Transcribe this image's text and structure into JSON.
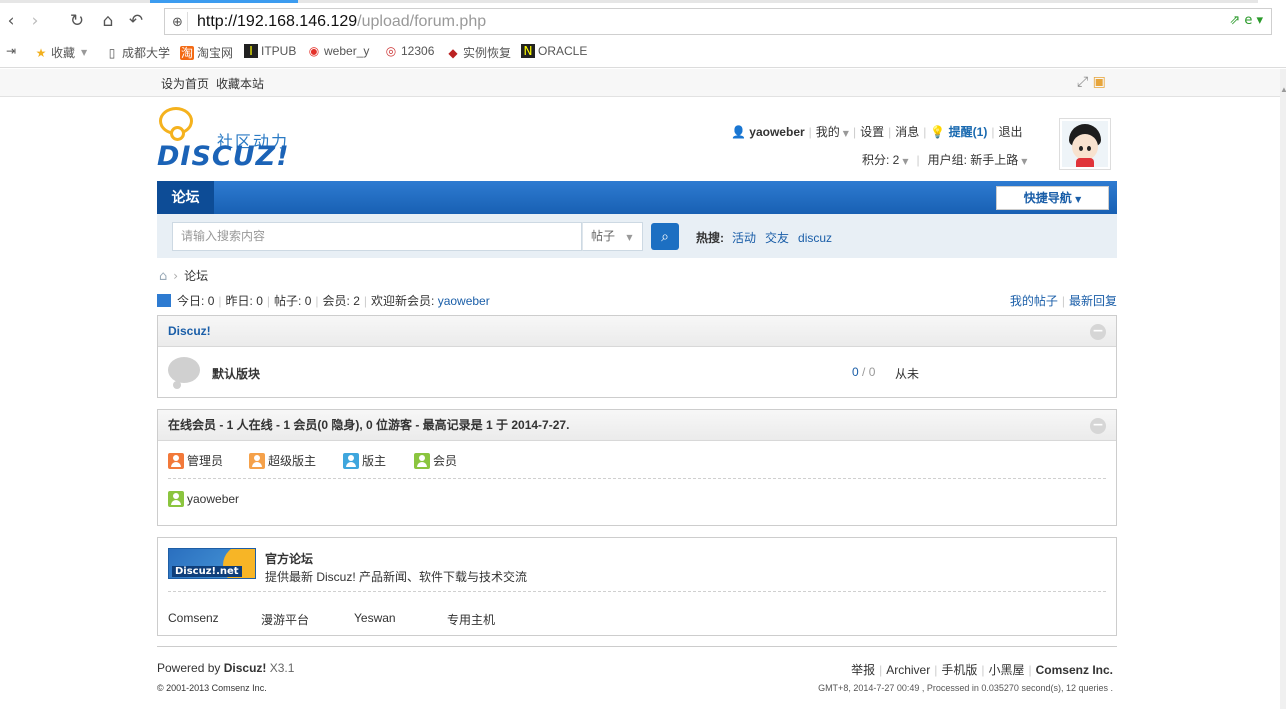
{
  "browser": {
    "url_host": "http://192.168.146.129",
    "url_path": "/upload/forum.php",
    "bookmarks": [
      "收藏",
      "成都大学",
      "淘宝网",
      "ITPUB",
      "weber_y",
      "12306",
      "实例恢复",
      "ORACLE"
    ]
  },
  "topbar": {
    "set_home": "设为首页",
    "bookmark_site": "收藏本站"
  },
  "logo": {
    "cn": "社区动力",
    "en": "DISCUZ!"
  },
  "user": {
    "name": "yaoweber",
    "my": "我的",
    "settings": "设置",
    "messages": "消息",
    "remind": "提醒(1)",
    "logout": "退出",
    "credits": "积分: 2",
    "group": "用户组: 新手上路"
  },
  "nav": {
    "forum_tab": "论坛",
    "quick_nav": "快捷导航"
  },
  "search": {
    "placeholder": "请输入搜索内容",
    "type": "帖子",
    "hot_label": "热搜:",
    "hot": [
      "活动",
      "交友",
      "discuz"
    ]
  },
  "breadcrumb": {
    "current": "论坛"
  },
  "stats": {
    "today_label": "今日:",
    "today": "0",
    "yesterday_label": "昨日:",
    "yesterday": "0",
    "posts_label": "帖子:",
    "posts": "0",
    "members_label": "会员:",
    "members": "2",
    "welcome_label": "欢迎新会员:",
    "newest": "yaoweber",
    "my_posts": "我的帖子",
    "latest_replies": "最新回复"
  },
  "category": {
    "title": "Discuz!",
    "forums": [
      {
        "name": "默认版块",
        "threads": "0",
        "posts": "0",
        "last": "从未"
      }
    ]
  },
  "online": {
    "title": "在线会员 - 1 人在线 - 1 会员(0 隐身), 0 位游客 - 最高记录是 1 于 2014-7-27.",
    "legend": [
      "管理员",
      "超级版主",
      "版主",
      "会员"
    ],
    "members": [
      "yaoweber"
    ]
  },
  "links": {
    "banner_text": "Discuz!.net",
    "title": "官方论坛",
    "desc": "提供最新 Discuz! 产品新闻、软件下载与技术交流",
    "items": [
      "Comsenz",
      "漫游平台",
      "Yeswan",
      "专用主机"
    ]
  },
  "footer": {
    "powered_by": "Powered by",
    "brand": "Discuz!",
    "version": "X3.1",
    "copyright": "© 2001-2013 Comsenz Inc.",
    "links": [
      "举报",
      "Archiver",
      "手机版",
      "小黑屋",
      "Comsenz Inc."
    ],
    "info": "GMT+8, 2014-7-27 00:49 , Processed in 0.035270 second(s), 12 queries ."
  },
  "colors": {
    "nav_blue": "#1860b3",
    "link_blue": "#1a5ea8",
    "admin": "#f2793a",
    "super_mod": "#f5a14a",
    "mod": "#3fa6dd",
    "member": "#8bc53f"
  }
}
